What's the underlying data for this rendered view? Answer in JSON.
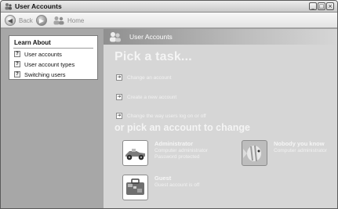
{
  "window": {
    "title": "User Accounts",
    "controls": {
      "minimize": "_",
      "maximize": "□",
      "close": "×"
    }
  },
  "toolbar": {
    "back_label": "Back",
    "home_label": "Home"
  },
  "sidebar": {
    "learn_about_title": "Learn About",
    "items": [
      {
        "label": "User accounts",
        "icon": "help-icon"
      },
      {
        "label": "User account types",
        "icon": "help-icon"
      },
      {
        "label": "Switching users",
        "icon": "help-icon"
      }
    ]
  },
  "main": {
    "header_title": "User Accounts",
    "pick_task_heading": "Pick a task...",
    "tasks": [
      {
        "label": "Change an account",
        "icon": "arrow-icon"
      },
      {
        "label": "Create a new account",
        "icon": "arrow-icon"
      },
      {
        "label": "Change the way users log on or off",
        "icon": "arrow-icon"
      }
    ],
    "pick_account_heading": "or pick an account to change",
    "accounts": [
      {
        "name": "Administrator",
        "lines": [
          "Computer administrator",
          "Password protected"
        ],
        "picture": "race-car-picture"
      },
      {
        "name": "Nobody you know",
        "lines": [
          "Computer administrator"
        ],
        "picture": "fish-picture"
      },
      {
        "name": "Guest",
        "lines": [
          "Guest account is off"
        ],
        "picture": "suitcase-picture"
      }
    ]
  },
  "colors": {
    "main_background": "#d6d6d6",
    "sidebar_background": "#a7a7a7",
    "heading_text": "#f4f4f4"
  }
}
